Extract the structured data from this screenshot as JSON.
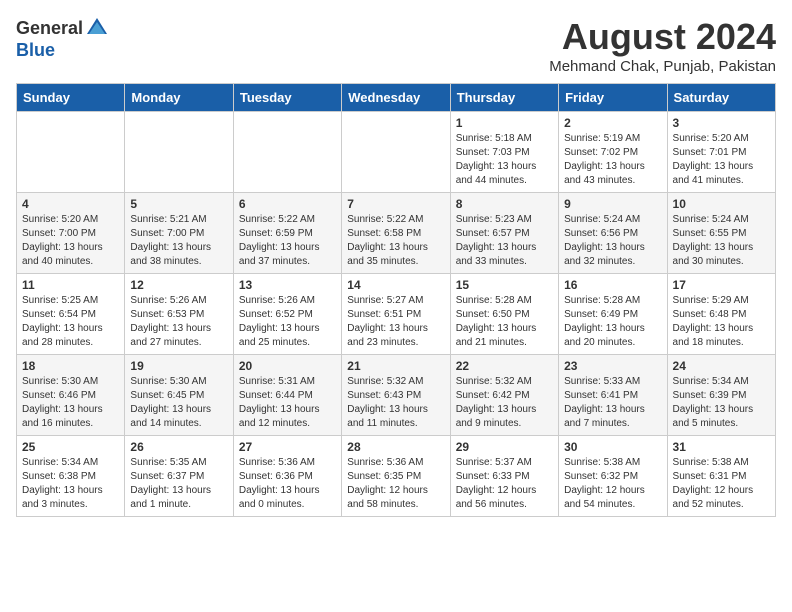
{
  "logo": {
    "general": "General",
    "blue": "Blue"
  },
  "title": "August 2024",
  "location": "Mehmand Chak, Punjab, Pakistan",
  "days_of_week": [
    "Sunday",
    "Monday",
    "Tuesday",
    "Wednesday",
    "Thursday",
    "Friday",
    "Saturday"
  ],
  "weeks": [
    [
      {
        "day": "",
        "info": ""
      },
      {
        "day": "",
        "info": ""
      },
      {
        "day": "",
        "info": ""
      },
      {
        "day": "",
        "info": ""
      },
      {
        "day": "1",
        "info": "Sunrise: 5:18 AM\nSunset: 7:03 PM\nDaylight: 13 hours\nand 44 minutes."
      },
      {
        "day": "2",
        "info": "Sunrise: 5:19 AM\nSunset: 7:02 PM\nDaylight: 13 hours\nand 43 minutes."
      },
      {
        "day": "3",
        "info": "Sunrise: 5:20 AM\nSunset: 7:01 PM\nDaylight: 13 hours\nand 41 minutes."
      }
    ],
    [
      {
        "day": "4",
        "info": "Sunrise: 5:20 AM\nSunset: 7:00 PM\nDaylight: 13 hours\nand 40 minutes."
      },
      {
        "day": "5",
        "info": "Sunrise: 5:21 AM\nSunset: 7:00 PM\nDaylight: 13 hours\nand 38 minutes."
      },
      {
        "day": "6",
        "info": "Sunrise: 5:22 AM\nSunset: 6:59 PM\nDaylight: 13 hours\nand 37 minutes."
      },
      {
        "day": "7",
        "info": "Sunrise: 5:22 AM\nSunset: 6:58 PM\nDaylight: 13 hours\nand 35 minutes."
      },
      {
        "day": "8",
        "info": "Sunrise: 5:23 AM\nSunset: 6:57 PM\nDaylight: 13 hours\nand 33 minutes."
      },
      {
        "day": "9",
        "info": "Sunrise: 5:24 AM\nSunset: 6:56 PM\nDaylight: 13 hours\nand 32 minutes."
      },
      {
        "day": "10",
        "info": "Sunrise: 5:24 AM\nSunset: 6:55 PM\nDaylight: 13 hours\nand 30 minutes."
      }
    ],
    [
      {
        "day": "11",
        "info": "Sunrise: 5:25 AM\nSunset: 6:54 PM\nDaylight: 13 hours\nand 28 minutes."
      },
      {
        "day": "12",
        "info": "Sunrise: 5:26 AM\nSunset: 6:53 PM\nDaylight: 13 hours\nand 27 minutes."
      },
      {
        "day": "13",
        "info": "Sunrise: 5:26 AM\nSunset: 6:52 PM\nDaylight: 13 hours\nand 25 minutes."
      },
      {
        "day": "14",
        "info": "Sunrise: 5:27 AM\nSunset: 6:51 PM\nDaylight: 13 hours\nand 23 minutes."
      },
      {
        "day": "15",
        "info": "Sunrise: 5:28 AM\nSunset: 6:50 PM\nDaylight: 13 hours\nand 21 minutes."
      },
      {
        "day": "16",
        "info": "Sunrise: 5:28 AM\nSunset: 6:49 PM\nDaylight: 13 hours\nand 20 minutes."
      },
      {
        "day": "17",
        "info": "Sunrise: 5:29 AM\nSunset: 6:48 PM\nDaylight: 13 hours\nand 18 minutes."
      }
    ],
    [
      {
        "day": "18",
        "info": "Sunrise: 5:30 AM\nSunset: 6:46 PM\nDaylight: 13 hours\nand 16 minutes."
      },
      {
        "day": "19",
        "info": "Sunrise: 5:30 AM\nSunset: 6:45 PM\nDaylight: 13 hours\nand 14 minutes."
      },
      {
        "day": "20",
        "info": "Sunrise: 5:31 AM\nSunset: 6:44 PM\nDaylight: 13 hours\nand 12 minutes."
      },
      {
        "day": "21",
        "info": "Sunrise: 5:32 AM\nSunset: 6:43 PM\nDaylight: 13 hours\nand 11 minutes."
      },
      {
        "day": "22",
        "info": "Sunrise: 5:32 AM\nSunset: 6:42 PM\nDaylight: 13 hours\nand 9 minutes."
      },
      {
        "day": "23",
        "info": "Sunrise: 5:33 AM\nSunset: 6:41 PM\nDaylight: 13 hours\nand 7 minutes."
      },
      {
        "day": "24",
        "info": "Sunrise: 5:34 AM\nSunset: 6:39 PM\nDaylight: 13 hours\nand 5 minutes."
      }
    ],
    [
      {
        "day": "25",
        "info": "Sunrise: 5:34 AM\nSunset: 6:38 PM\nDaylight: 13 hours\nand 3 minutes."
      },
      {
        "day": "26",
        "info": "Sunrise: 5:35 AM\nSunset: 6:37 PM\nDaylight: 13 hours\nand 1 minute."
      },
      {
        "day": "27",
        "info": "Sunrise: 5:36 AM\nSunset: 6:36 PM\nDaylight: 13 hours\nand 0 minutes."
      },
      {
        "day": "28",
        "info": "Sunrise: 5:36 AM\nSunset: 6:35 PM\nDaylight: 12 hours\nand 58 minutes."
      },
      {
        "day": "29",
        "info": "Sunrise: 5:37 AM\nSunset: 6:33 PM\nDaylight: 12 hours\nand 56 minutes."
      },
      {
        "day": "30",
        "info": "Sunrise: 5:38 AM\nSunset: 6:32 PM\nDaylight: 12 hours\nand 54 minutes."
      },
      {
        "day": "31",
        "info": "Sunrise: 5:38 AM\nSunset: 6:31 PM\nDaylight: 12 hours\nand 52 minutes."
      }
    ]
  ]
}
